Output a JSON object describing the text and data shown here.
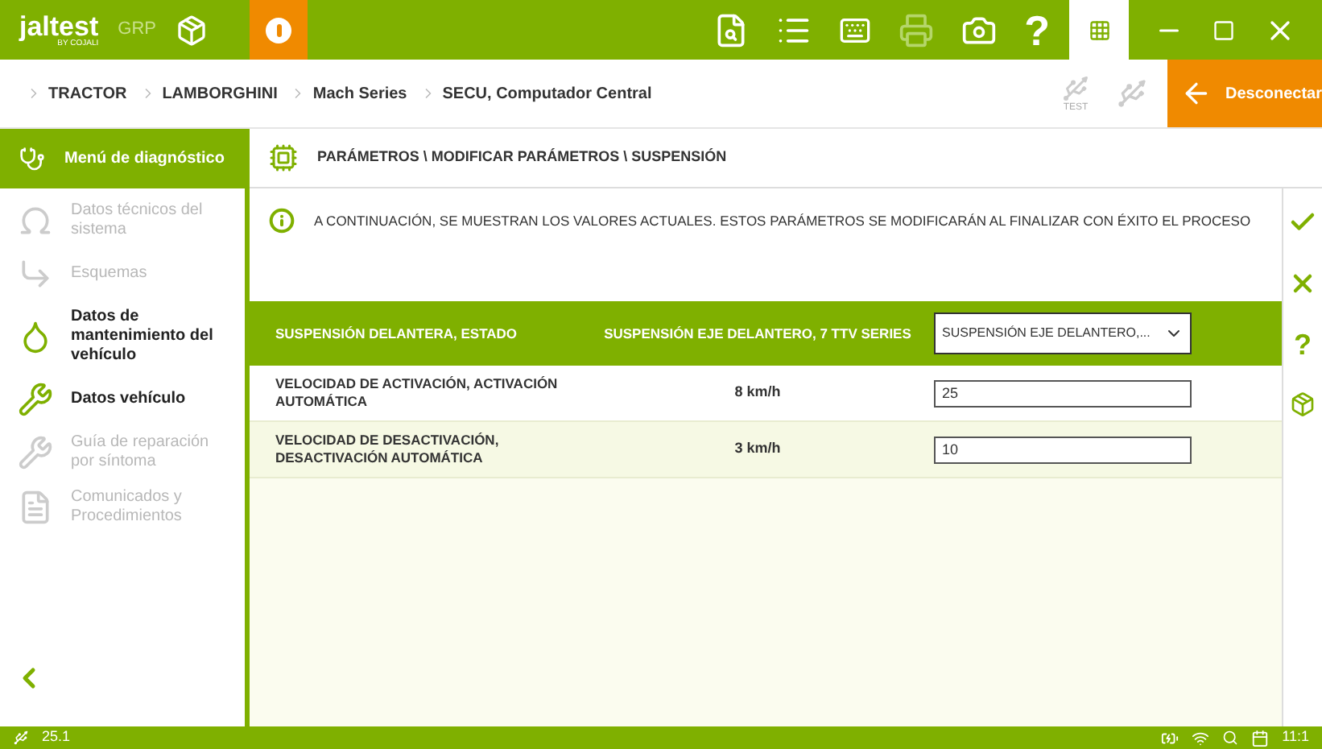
{
  "topbar": {
    "logo": "jaltest",
    "logo_sub": "BY COJALI",
    "mode": "GRP"
  },
  "breadcrumb": [
    "TRACTOR",
    "LAMBORGHINI",
    "Mach Series",
    "SECU, Computador Central"
  ],
  "test_label": "TEST",
  "disconnect": "Desconectar",
  "sidebar": {
    "title": "Menú de diagnóstico",
    "items": [
      {
        "label": "Datos técnicos del sistema",
        "disabled": true
      },
      {
        "label": "Esquemas",
        "disabled": true
      },
      {
        "label": "Datos de mantenimiento del vehículo",
        "disabled": false
      },
      {
        "label": "Datos vehículo",
        "disabled": false
      },
      {
        "label": "Guía de reparación por síntoma",
        "disabled": true
      },
      {
        "label": "Comunicados y Procedimientos",
        "disabled": true
      }
    ]
  },
  "toolbar_help": "?",
  "side_help": "?",
  "header": "PARÁMETROS \\ MODIFICAR PARÁMETROS \\ SUSPENSIÓN",
  "info": "A CONTINUACIÓN, SE MUESTRAN LOS VALORES ACTUALES. ESTOS PARÁMETROS SE MODIFICARÁN AL FINALIZAR CON ÉXITO EL PROCESO",
  "table": {
    "header": {
      "name": "SUSPENSIÓN DELANTERA, ESTADO",
      "current": "SUSPENSIÓN EJE DELANTERO, 7 TTV SERIES",
      "value": "SUSPENSIÓN EJE DELANTERO,..."
    },
    "rows": [
      {
        "name": "VELOCIDAD DE ACTIVACIÓN, ACTIVACIÓN AUTOMÁTICA",
        "current": "8 km/h",
        "value": "25"
      },
      {
        "name": "VELOCIDAD DE DESACTIVACIÓN, DESACTIVACIÓN AUTOMÁTICA",
        "current": "3 km/h",
        "value": "10"
      }
    ]
  },
  "status_bar": {
    "version": "25.1",
    "time": "11:1"
  }
}
